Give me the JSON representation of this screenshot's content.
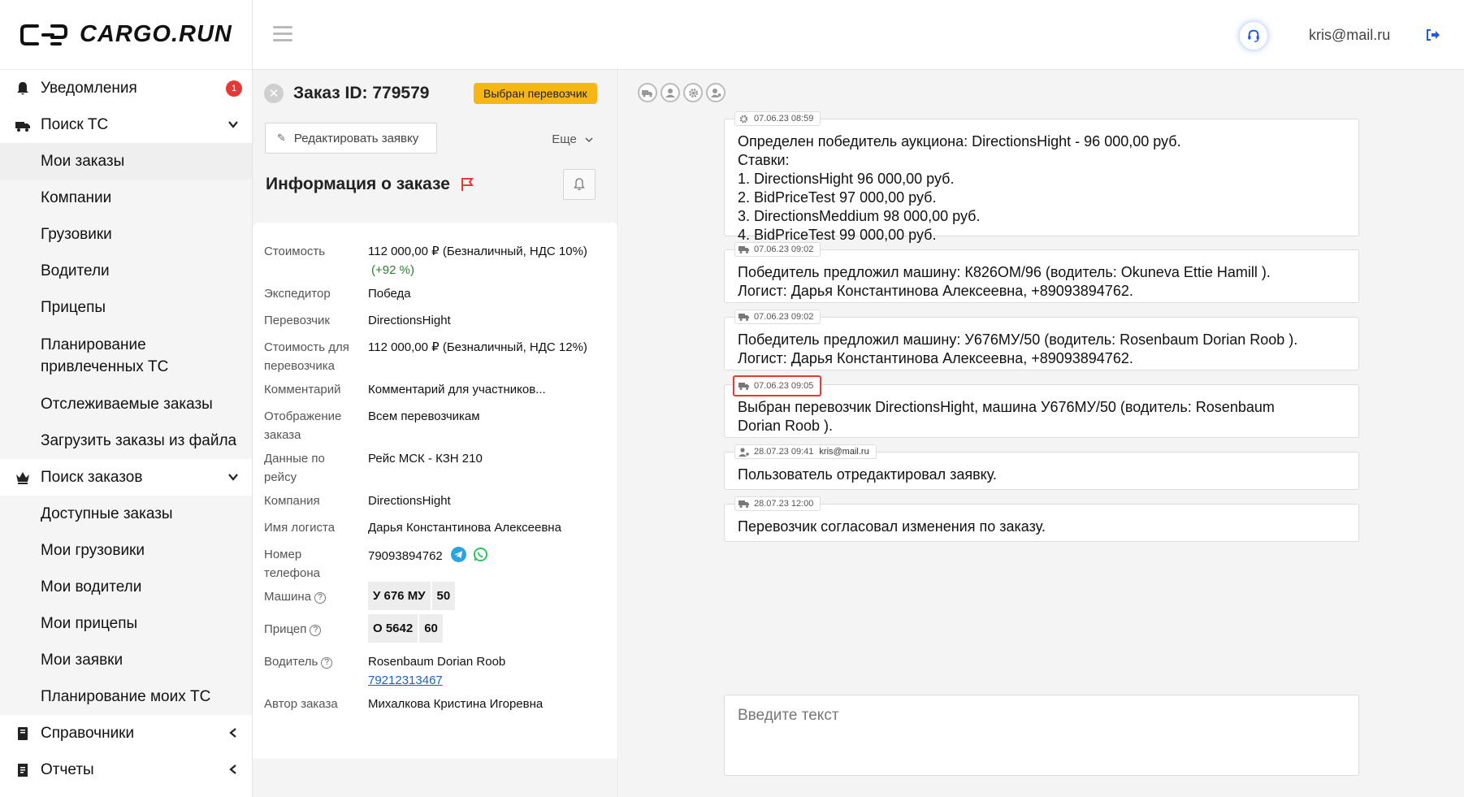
{
  "brand": {
    "name": "CARGO.RUN"
  },
  "sidebar": {
    "items": [
      {
        "label": "Уведомления",
        "badge": "1"
      },
      {
        "label": "Поиск ТС"
      },
      {
        "label": "Мои заказы"
      },
      {
        "label": "Компании"
      },
      {
        "label": "Грузовики"
      },
      {
        "label": "Водители"
      },
      {
        "label": "Прицепы"
      },
      {
        "label": "Планирование привлеченных ТС"
      },
      {
        "label": "Отслеживаемые заказы"
      },
      {
        "label": "Загрузить заказы из файла"
      },
      {
        "label": "Поиск заказов"
      },
      {
        "label": "Доступные заказы"
      },
      {
        "label": "Мои грузовики"
      },
      {
        "label": "Мои водители"
      },
      {
        "label": "Мои прицепы"
      },
      {
        "label": "Мои заявки"
      },
      {
        "label": "Планирование моих ТС"
      },
      {
        "label": "Справочники"
      },
      {
        "label": "Отчеты"
      }
    ]
  },
  "header": {
    "user_email": "kris@mail.ru"
  },
  "order": {
    "title": "Заказ ID: 779579",
    "status": "Выбран перевозчик",
    "edit_label": "Редактировать заявку",
    "more_label": "Еще",
    "info_title": "Информация о заказе",
    "fields": {
      "cost_label": "Стоимость",
      "cost_value": "112 000,00 ₽ (Безналичный, НДС 10%)",
      "cost_delta": "(+92 %)",
      "forwarder_label": "Экспедитор",
      "forwarder_value": "Победа",
      "carrier_label": "Перевозчик",
      "carrier_value": "DirectionsHight",
      "carrier_cost_label": "Стоимость для перевозчика",
      "carrier_cost_value": "112 000,00 ₽ (Безналичный, НДС 12%)",
      "comment_label": "Комментарий",
      "comment_value": "Комментарий для участников...",
      "display_label": "Отображение заказа",
      "display_value": "Всем перевозчикам",
      "route_label": "Данные по рейсу",
      "route_value": "Рейс МСК - КЗН 210",
      "company_label": "Компания",
      "company_value": "DirectionsHight",
      "logist_label": "Имя логиста",
      "logist_value": "Дарья Константинова Алексеевна",
      "phone_label": "Номер телефона",
      "phone_value": "79093894762",
      "truck_label": "Машина",
      "truck_plate": "У 676 МУ",
      "truck_region": "50",
      "trailer_label": "Прицеп",
      "trailer_plate": "О 5642",
      "trailer_region": "60",
      "driver_label": "Водитель",
      "driver_name": "Rosenbaum Dorian Roob",
      "driver_phone": "79212313467",
      "author_label": "Автор заказа",
      "author_value": "Михалкова Кристина Игоревна"
    }
  },
  "chat": {
    "messages": [
      {
        "icon": "gear-icon",
        "time": "07.06.23 08:59",
        "lines": [
          "Определен победитель аукциона: DirectionsHight - 96 000,00 руб.",
          "Ставки:",
          "1. DirectionsHight 96 000,00 руб.",
          "2. BidPriceTest 97 000,00 руб.",
          "3. DirectionsMeddium 98 000,00 руб.",
          "4. BidPriceTest 99 000,00 руб."
        ]
      },
      {
        "icon": "truck-icon",
        "time": "07.06.23 09:02",
        "lines": [
          "Победитель предложил машину: К826ОМ/96 (водитель:  Okuneva Ettie Hamill ).",
          "Логист: Дарья Константинова Алексеевна, +89093894762."
        ]
      },
      {
        "icon": "truck-icon",
        "time": "07.06.23 09:02",
        "lines": [
          "Победитель предложил машину: У676МУ/50 (водитель:  Rosenbaum Dorian Roob ).",
          "Логист: Дарья Константинова Алексеевна, +89093894762."
        ]
      },
      {
        "icon": "truck-icon",
        "time": "07.06.23 09:05",
        "lines": [
          "Выбран перевозчик DirectionsHight, машина У676МУ/50 (водитель:  Rosenbaum",
          "Dorian Roob )."
        ]
      },
      {
        "icon": "user-icon",
        "time": "28.07.23 09:41",
        "author": "kris@mail.ru",
        "lines": [
          "Пользователь отредактировал заявку."
        ]
      },
      {
        "icon": "truck-icon",
        "time": "28.07.23 12:00",
        "lines": [
          "Перевозчик согласовал изменения по заказу."
        ]
      }
    ],
    "input_placeholder": "Введите текст"
  },
  "colors": {
    "accent_badge": "#f7b614",
    "notification_badge": "#e53935",
    "highlight": "#e53935",
    "link": "#1565c0"
  }
}
